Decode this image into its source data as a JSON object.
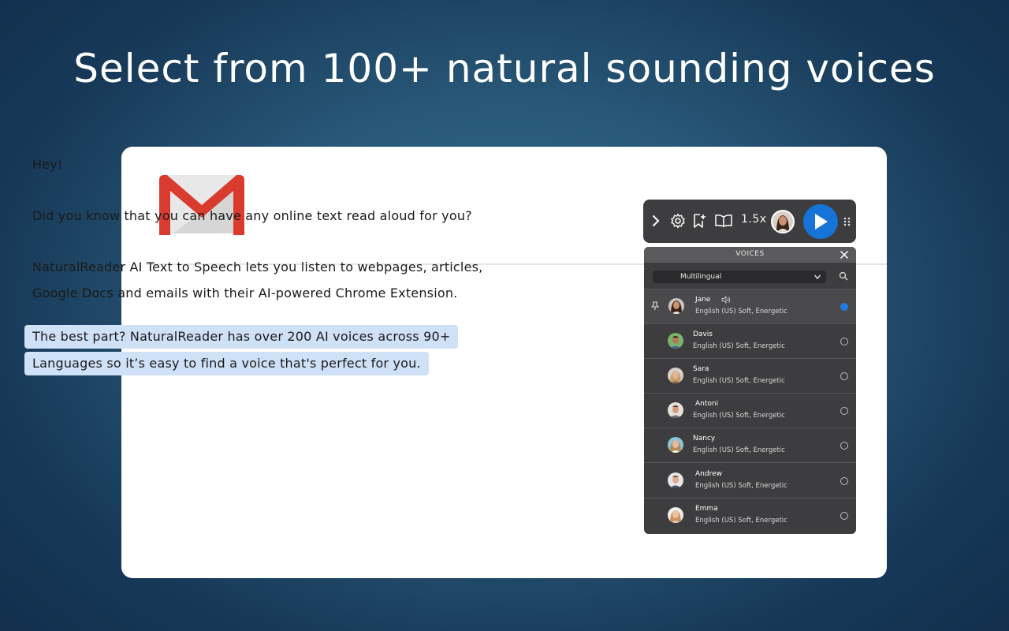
{
  "headline": "Select from 100+ natural sounding voices",
  "email": {
    "greeting": "Hey!",
    "line1": "Did you know that you can have any online text read aloud for you?",
    "line2a": "NaturalReader AI Text to Speech lets you listen to webpages, articles,",
    "line2b": "Google Docs and emails with their AI-powered Chrome Extension.",
    "highlight_a": "The best part? NaturalReader has over 200 AI voices across 90+",
    "highlight_b": "Languages so it’s easy to find a voice that's perfect for you."
  },
  "toolbar": {
    "speed": "1.5x",
    "icons": [
      "chevron-right-icon",
      "gear-icon",
      "bookmark-add-icon",
      "book-icon",
      "play-icon",
      "drag-handle-icon"
    ]
  },
  "voices_panel": {
    "title": "VOICES",
    "language_filter": "Multilingual",
    "voices": [
      {
        "name": "Jane",
        "desc": "English (US) Soft, Energetic",
        "selected": true
      },
      {
        "name": "Davis",
        "desc": "English (US) Soft, Energetic",
        "selected": false
      },
      {
        "name": "Sara",
        "desc": "English (US) Soft, Energetic",
        "selected": false
      },
      {
        "name": "Antoni",
        "desc": "English (US) Soft, Energetic",
        "selected": false
      },
      {
        "name": "Nancy",
        "desc": "English (US) Soft, Energetic",
        "selected": false
      },
      {
        "name": "Andrew",
        "desc": "English (US) Soft, Energetic",
        "selected": false
      },
      {
        "name": "Emma",
        "desc": "English (US) Soft, Energetic",
        "selected": false
      }
    ]
  },
  "colors": {
    "accent": "#1673d8",
    "highlight": "#cfe1f7",
    "panel_bg": "#3d3d3f"
  }
}
